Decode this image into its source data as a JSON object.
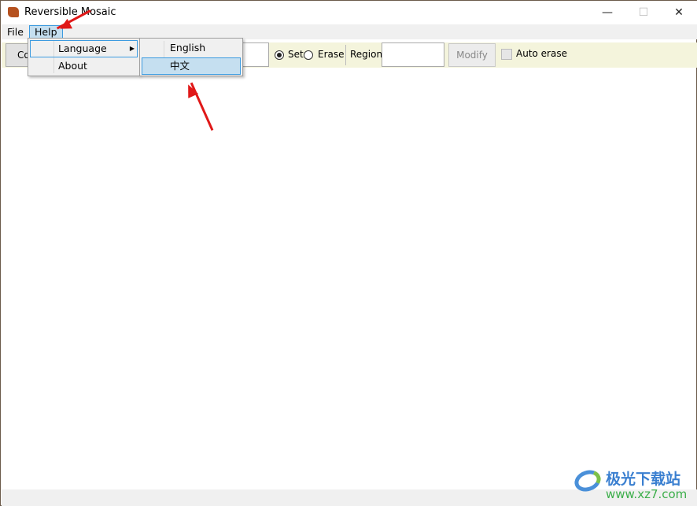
{
  "window": {
    "title": "Reversible Mosaic",
    "minimize": "—",
    "maximize": "☐",
    "close": "✕"
  },
  "menubar": {
    "items": [
      {
        "label": "File"
      },
      {
        "label": "Help"
      }
    ]
  },
  "help_menu": {
    "items": [
      {
        "label": "Language",
        "has_submenu": true
      },
      {
        "label": "About"
      }
    ]
  },
  "language_submenu": {
    "items": [
      {
        "label": "English"
      },
      {
        "label": "中文",
        "highlighted": true
      }
    ]
  },
  "toolbar": {
    "first_button_label": "Co",
    "mode_options": [
      {
        "label": "Set",
        "checked": true
      },
      {
        "label": "Erase",
        "checked": false
      }
    ],
    "region_label": "Region",
    "region_value": "",
    "modify_label": "Modify",
    "auto_erase_label": "Auto erase",
    "auto_erase_checked": false
  },
  "watermark": {
    "name": "极光下载站",
    "url": "www.xz7.com"
  },
  "colors": {
    "highlight": "#c5dff0",
    "highlight_border": "#3c9be0",
    "toolbar_bg": "#f4f4dc",
    "arrow": "#e01818"
  }
}
